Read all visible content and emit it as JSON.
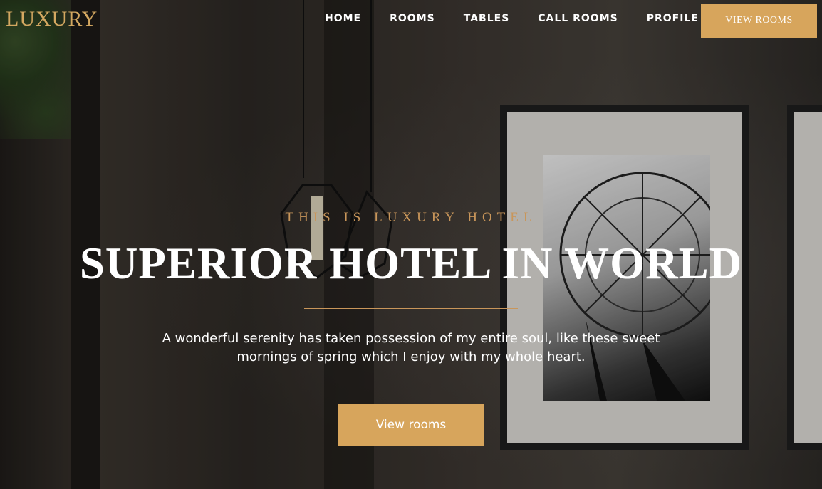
{
  "brand": {
    "logo_text": "LUXURY"
  },
  "nav": {
    "items": [
      {
        "label": "HOME"
      },
      {
        "label": "ROOMS"
      },
      {
        "label": "TABLES"
      },
      {
        "label": "CALL ROOMS"
      },
      {
        "label": "PROFILE"
      }
    ],
    "cta_label": "VIEW ROOMS"
  },
  "hero": {
    "eyebrow": "THIS IS LUXURY HOTEL",
    "headline": "SUPERIOR HOTEL IN WORLD",
    "subtitle": "A wonderful serenity has taken possession of my entire soul, like these sweet mornings of spring which I enjoy with my whole heart.",
    "cta_label": "View rooms"
  },
  "colors": {
    "accent": "#d7a55c",
    "eyebrow": "#c9965a",
    "text": "#ffffff"
  },
  "icons": {
    "background": "hotel-interior-photo"
  }
}
